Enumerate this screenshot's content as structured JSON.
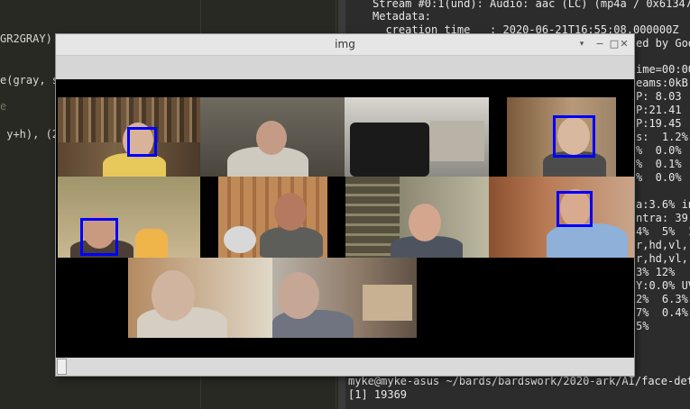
{
  "editor": {
    "lines": [
      "GR2GRAY)",
      "e(gray, s",
      "e",
      " y+h), (2"
    ]
  },
  "terminal": {
    "top_lines": [
      "Stream #0:1(und): Audio: aac (LC) (mp4a / 0x6134700",
      "Metadata:",
      "  creation_time   : 2020-06-21T16:55:08.000000Z"
    ],
    "right_lines": [
      "ed by Goo",
      "ime=00:00",
      "eams:0kB (",
      "P: 8.03",
      "P:21.41",
      "P:19.45",
      "s:  1.2%",
      "%  0.0%",
      "%  0.1%",
      "%  0.0%",
      "a:3.6% in",
      "ntra: 39",
      "4%  5%  1",
      "r,hd,vl,",
      "r,hd,vl,",
      "3% 12%",
      "Y:0.0% UV",
      "2%  6.3%",
      "7%  0.4%",
      "5%"
    ],
    "prompt": "myke@myke-asus ~/bards/bardswork/2020-ark/AI/face-detect",
    "job": "[1] 19369"
  },
  "window": {
    "title": "img",
    "minimize": "−",
    "maximize": "□",
    "close": "✕"
  }
}
